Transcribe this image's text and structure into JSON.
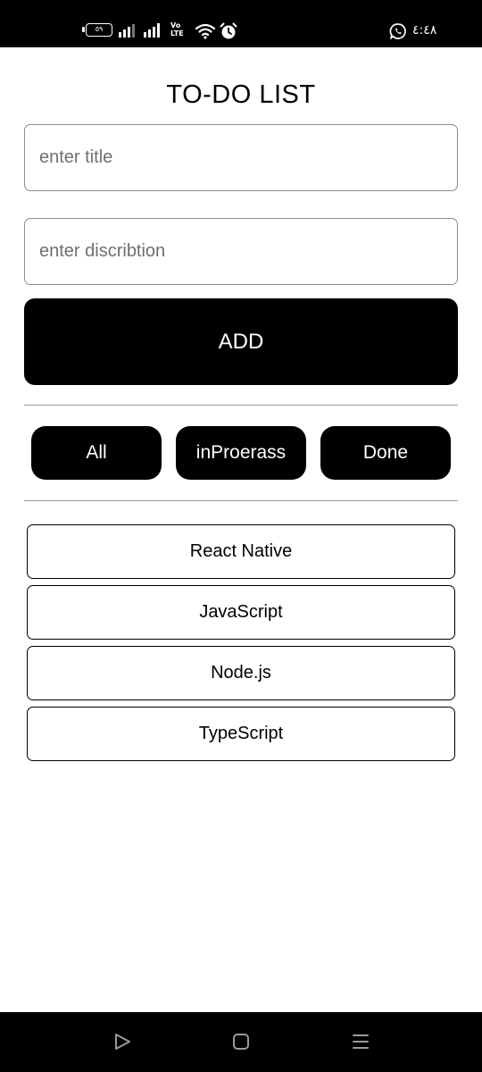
{
  "status_bar": {
    "battery_level": "٥٩",
    "network_label": "Vo\nLTE",
    "time": "٤:٤٨",
    "icons": [
      "battery-icon",
      "signal-icon",
      "signal-icon",
      "volte-icon",
      "wifi-icon",
      "alarm-icon",
      "whatsapp-icon"
    ]
  },
  "header": {
    "title": "TO-DO LIST"
  },
  "form": {
    "title_placeholder": "enter title",
    "title_value": "",
    "description_placeholder": "enter discribtion",
    "description_value": "",
    "add_label": "ADD"
  },
  "filters": [
    {
      "label": "All"
    },
    {
      "label": "inProerass"
    },
    {
      "label": "Done"
    }
  ],
  "tasks": [
    {
      "title": "React Native"
    },
    {
      "title": "JavaScript"
    },
    {
      "title": "Node.js"
    },
    {
      "title": "TypeScript"
    }
  ],
  "nav_bar": {
    "icons": [
      "back-icon",
      "home-icon",
      "recents-icon"
    ]
  },
  "colors": {
    "background": "#ffffff",
    "primary": "#000000",
    "on_primary": "#ffffff",
    "field_border": "#8c8c8c",
    "placeholder": "#6f6f6f"
  }
}
